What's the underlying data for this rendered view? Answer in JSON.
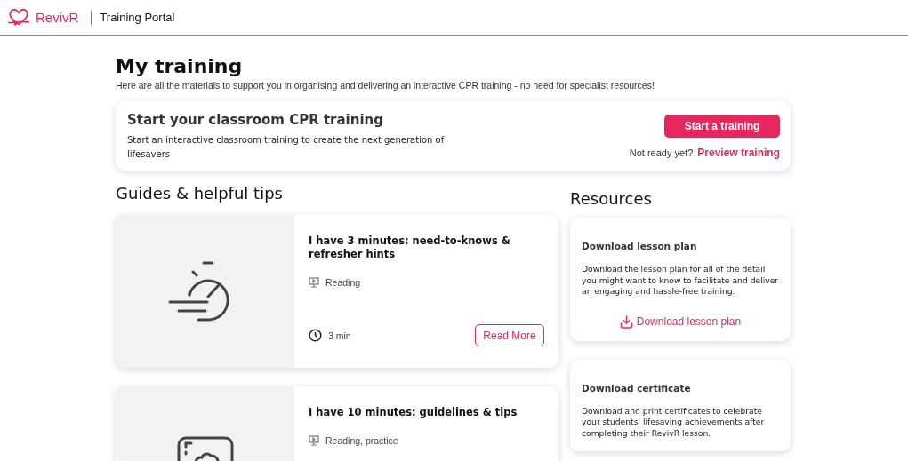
{
  "header": {
    "brand": "RevivR",
    "portal": "Training Portal"
  },
  "page": {
    "title": "My training",
    "intro": "Here are all the materials to support you in organising and delivering an interactive CPR training - no need for specialist resources!"
  },
  "start_card": {
    "title": "Start your classroom CPR training",
    "text": "Start an interactive classroom training to create the next generation of lifesavers",
    "button": "Start a training",
    "prompt": "Not ready yet?",
    "link": "Preview training"
  },
  "guides": {
    "heading": "Guides & helpful tips",
    "cards": [
      {
        "title": "I have 3 minutes: need-to-knows & refresher hints",
        "format": "Reading",
        "duration": "3 min",
        "button": "Read More"
      },
      {
        "title": "I have 10 minutes: guidelines & tips",
        "format": "Reading, practice"
      }
    ]
  },
  "resources": {
    "heading": "Resources",
    "cards": [
      {
        "title": "Download lesson plan",
        "text": "Download the lesson plan for all of the detail you might want to know to facilitate and deliver an engaging and hassle-free training.",
        "link": "Download lesson plan"
      },
      {
        "title": "Download certificate",
        "text": "Download and print certificates to celebrate your students' lifesaving achievements after completing their RevivR lesson."
      }
    ]
  }
}
